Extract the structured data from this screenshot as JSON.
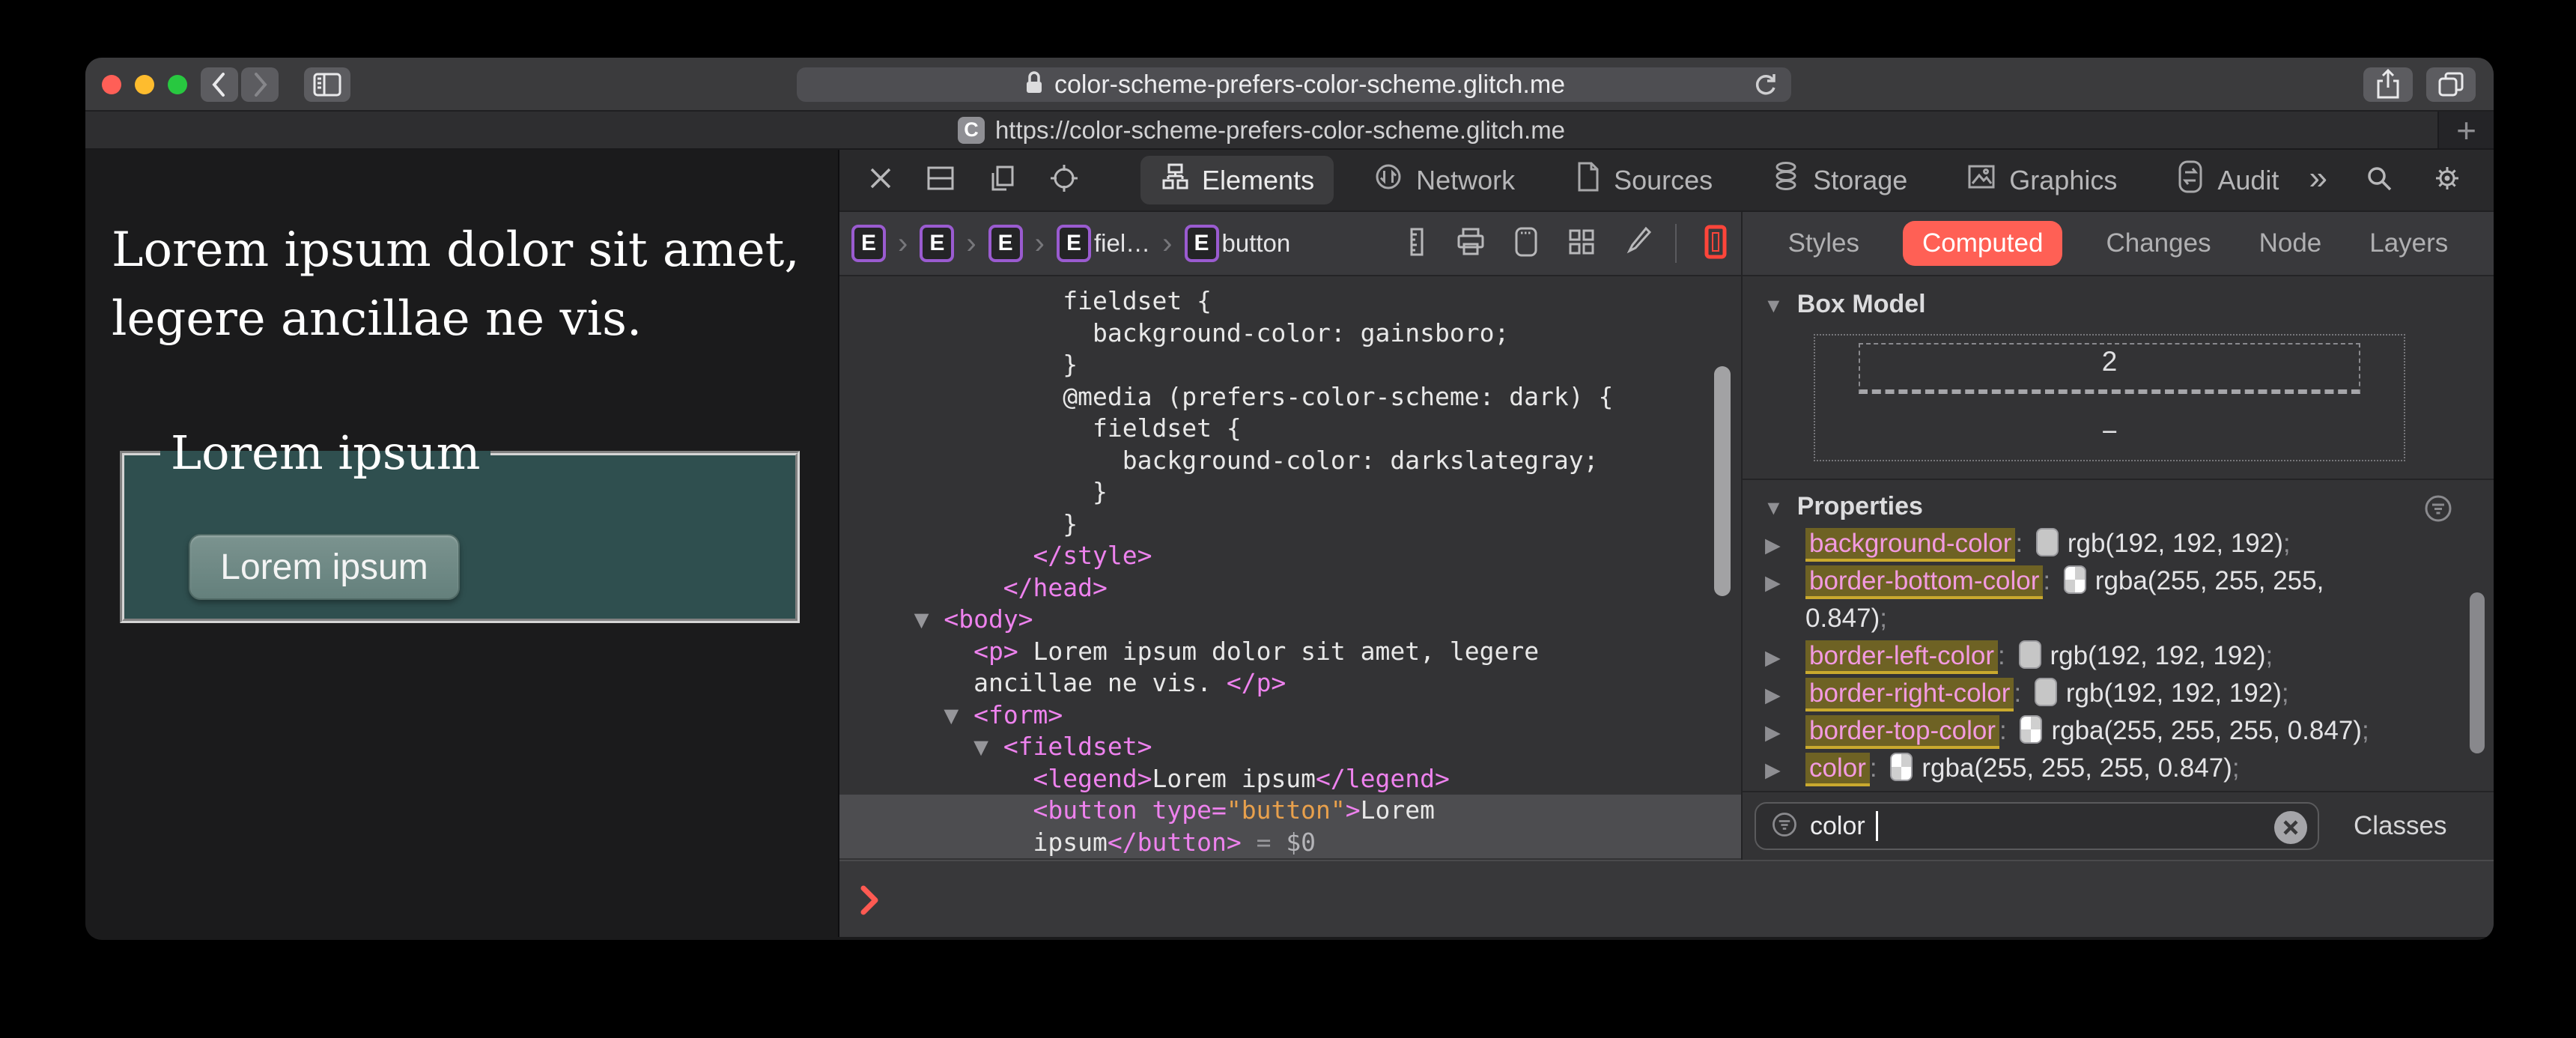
{
  "window": {
    "titlebar": {
      "url": "color-scheme-prefers-color-scheme.glitch.me"
    },
    "tab": {
      "favicon_letter": "C",
      "url": "https://color-scheme-prefers-color-scheme.glitch.me",
      "new_tab_label": "+"
    }
  },
  "page": {
    "paragraph": "Lorem ipsum dolor sit amet, legere ancillae ne vis.",
    "fieldset_legend": "Lorem ipsum",
    "button_label": "Lorem ipsum"
  },
  "devtools": {
    "toolbar": {
      "tabs": [
        {
          "id": "elements",
          "label": "Elements",
          "active": true
        },
        {
          "id": "network",
          "label": "Network",
          "active": false
        },
        {
          "id": "sources",
          "label": "Sources",
          "active": false
        },
        {
          "id": "storage",
          "label": "Storage",
          "active": false
        },
        {
          "id": "graphics",
          "label": "Graphics",
          "active": false
        },
        {
          "id": "audit",
          "label": "Audit",
          "active": false
        }
      ],
      "more_label": "»"
    },
    "breadcrumbs": [
      {
        "badge": "E",
        "label": ""
      },
      {
        "badge": "E",
        "label": ""
      },
      {
        "badge": "E",
        "label": ""
      },
      {
        "badge": "E",
        "label": "fiel…"
      },
      {
        "badge": "E",
        "label": "button"
      }
    ],
    "code": {
      "lines": [
        {
          "sel": false,
          "seg": [
            [
              "p",
              "             fieldset {"
            ]
          ]
        },
        {
          "sel": false,
          "seg": [
            [
              "p",
              "               background-color: gainsboro;"
            ]
          ]
        },
        {
          "sel": false,
          "seg": [
            [
              "p",
              "             }"
            ]
          ]
        },
        {
          "sel": false,
          "seg": [
            [
              "p",
              "             @media (prefers-color-scheme: dark) {"
            ]
          ]
        },
        {
          "sel": false,
          "seg": [
            [
              "p",
              "               fieldset {"
            ]
          ]
        },
        {
          "sel": false,
          "seg": [
            [
              "p",
              "                 background-color: darkslategray;"
            ]
          ]
        },
        {
          "sel": false,
          "seg": [
            [
              "p",
              "               }"
            ]
          ]
        },
        {
          "sel": false,
          "seg": [
            [
              "p",
              "             }"
            ]
          ]
        },
        {
          "sel": false,
          "seg": [
            [
              "t",
              "           </style>"
            ]
          ]
        },
        {
          "sel": false,
          "seg": [
            [
              "t",
              "         </head>"
            ]
          ]
        },
        {
          "sel": false,
          "seg": [
            [
              "g",
              "   ▼ "
            ],
            [
              "t",
              "<body>"
            ]
          ]
        },
        {
          "sel": false,
          "seg": [
            [
              "p",
              "       "
            ],
            [
              "t",
              "<p>"
            ],
            [
              "p",
              " Lorem ipsum dolor sit amet, legere"
            ]
          ]
        },
        {
          "sel": false,
          "seg": [
            [
              "p",
              "       ancillae ne vis. "
            ],
            [
              "t",
              "</p>"
            ]
          ]
        },
        {
          "sel": false,
          "seg": [
            [
              "g",
              "     ▼ "
            ],
            [
              "t",
              "<form>"
            ]
          ]
        },
        {
          "sel": false,
          "seg": [
            [
              "g",
              "       ▼ "
            ],
            [
              "t",
              "<fieldset>"
            ]
          ]
        },
        {
          "sel": false,
          "seg": [
            [
              "p",
              "           "
            ],
            [
              "t",
              "<legend>"
            ],
            [
              "p",
              "Lorem ipsum"
            ],
            [
              "t",
              "</legend>"
            ]
          ]
        },
        {
          "sel": true,
          "seg": [
            [
              "p",
              "           "
            ],
            [
              "t",
              "<button "
            ],
            [
              "t",
              "type="
            ],
            [
              "s",
              "\"button\""
            ],
            [
              "t",
              ">"
            ],
            [
              "p",
              "Lorem"
            ]
          ]
        },
        {
          "sel": true,
          "seg": [
            [
              "p",
              "           ipsum"
            ],
            [
              "t",
              "</button>"
            ],
            [
              "g",
              " = "
            ],
            [
              "m",
              "$0"
            ]
          ]
        }
      ]
    },
    "sidebar": {
      "tabs": [
        {
          "label": "Styles",
          "active": false
        },
        {
          "label": "Computed",
          "active": true
        },
        {
          "label": "Changes",
          "active": false
        },
        {
          "label": "Node",
          "active": false
        },
        {
          "label": "Layers",
          "active": false
        }
      ],
      "box_model": {
        "title": "Box Model",
        "top_value": "2",
        "bottom_value": "−"
      },
      "properties": {
        "title": "Properties",
        "rows": [
          {
            "name": "background-color",
            "swatch": "solid",
            "value": "rgb(192, 192, 192)",
            "value2": null
          },
          {
            "name": "border-bottom-color",
            "swatch": "checker",
            "value": "rgba(255, 255, 255,",
            "value2": "0.847)"
          },
          {
            "name": "border-left-color",
            "swatch": "solid",
            "value": "rgb(192, 192, 192)",
            "value2": null
          },
          {
            "name": "border-right-color",
            "swatch": "solid",
            "value": "rgb(192, 192, 192)",
            "value2": null
          },
          {
            "name": "border-top-color",
            "swatch": "checker",
            "value": "rgba(255, 255, 255, 0.847)",
            "value2": null
          },
          {
            "name": "color",
            "swatch": "checker",
            "value": "rgba(255, 255, 255, 0.847)",
            "value2": null
          }
        ]
      },
      "filter": {
        "value": "color",
        "classes_label": "Classes"
      }
    }
  },
  "colors": {
    "accent_red": "#ff6055",
    "badge_purple": "#9a5bd0",
    "tag_pink": "#ee82ee",
    "attr_orange": "#e8a04c",
    "match_highlight": "#6e6224",
    "match_underline": "#c9a92e",
    "fieldset_teal": "#2f4f4f",
    "traffic_red": "#ff5f57",
    "traffic_yellow": "#febc2e",
    "traffic_green": "#28c840"
  }
}
